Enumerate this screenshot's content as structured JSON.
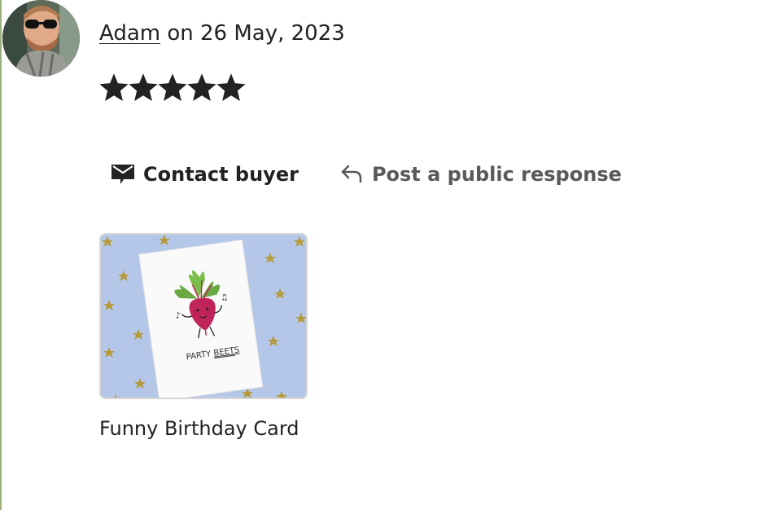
{
  "review": {
    "reviewer_name": "Adam",
    "date_text": "on 26 May, 2023",
    "rating": 5,
    "rating_max": 5
  },
  "actions": {
    "contact_label": "Contact buyer",
    "contact_icon": "envelope-icon",
    "post_label": "Post a public response",
    "post_icon": "reply-arrow-icon"
  },
  "product": {
    "title": "Funny Birthday Card",
    "card_text_1": "PARTY",
    "card_text_2": "BEETS"
  },
  "colors": {
    "accent_rule": "#9bb07a",
    "text_primary": "#222222",
    "text_secondary": "#595959",
    "thumb_background": "#b4c7e9",
    "star_gold": "#b59a3a",
    "beet": "#c0245a"
  }
}
